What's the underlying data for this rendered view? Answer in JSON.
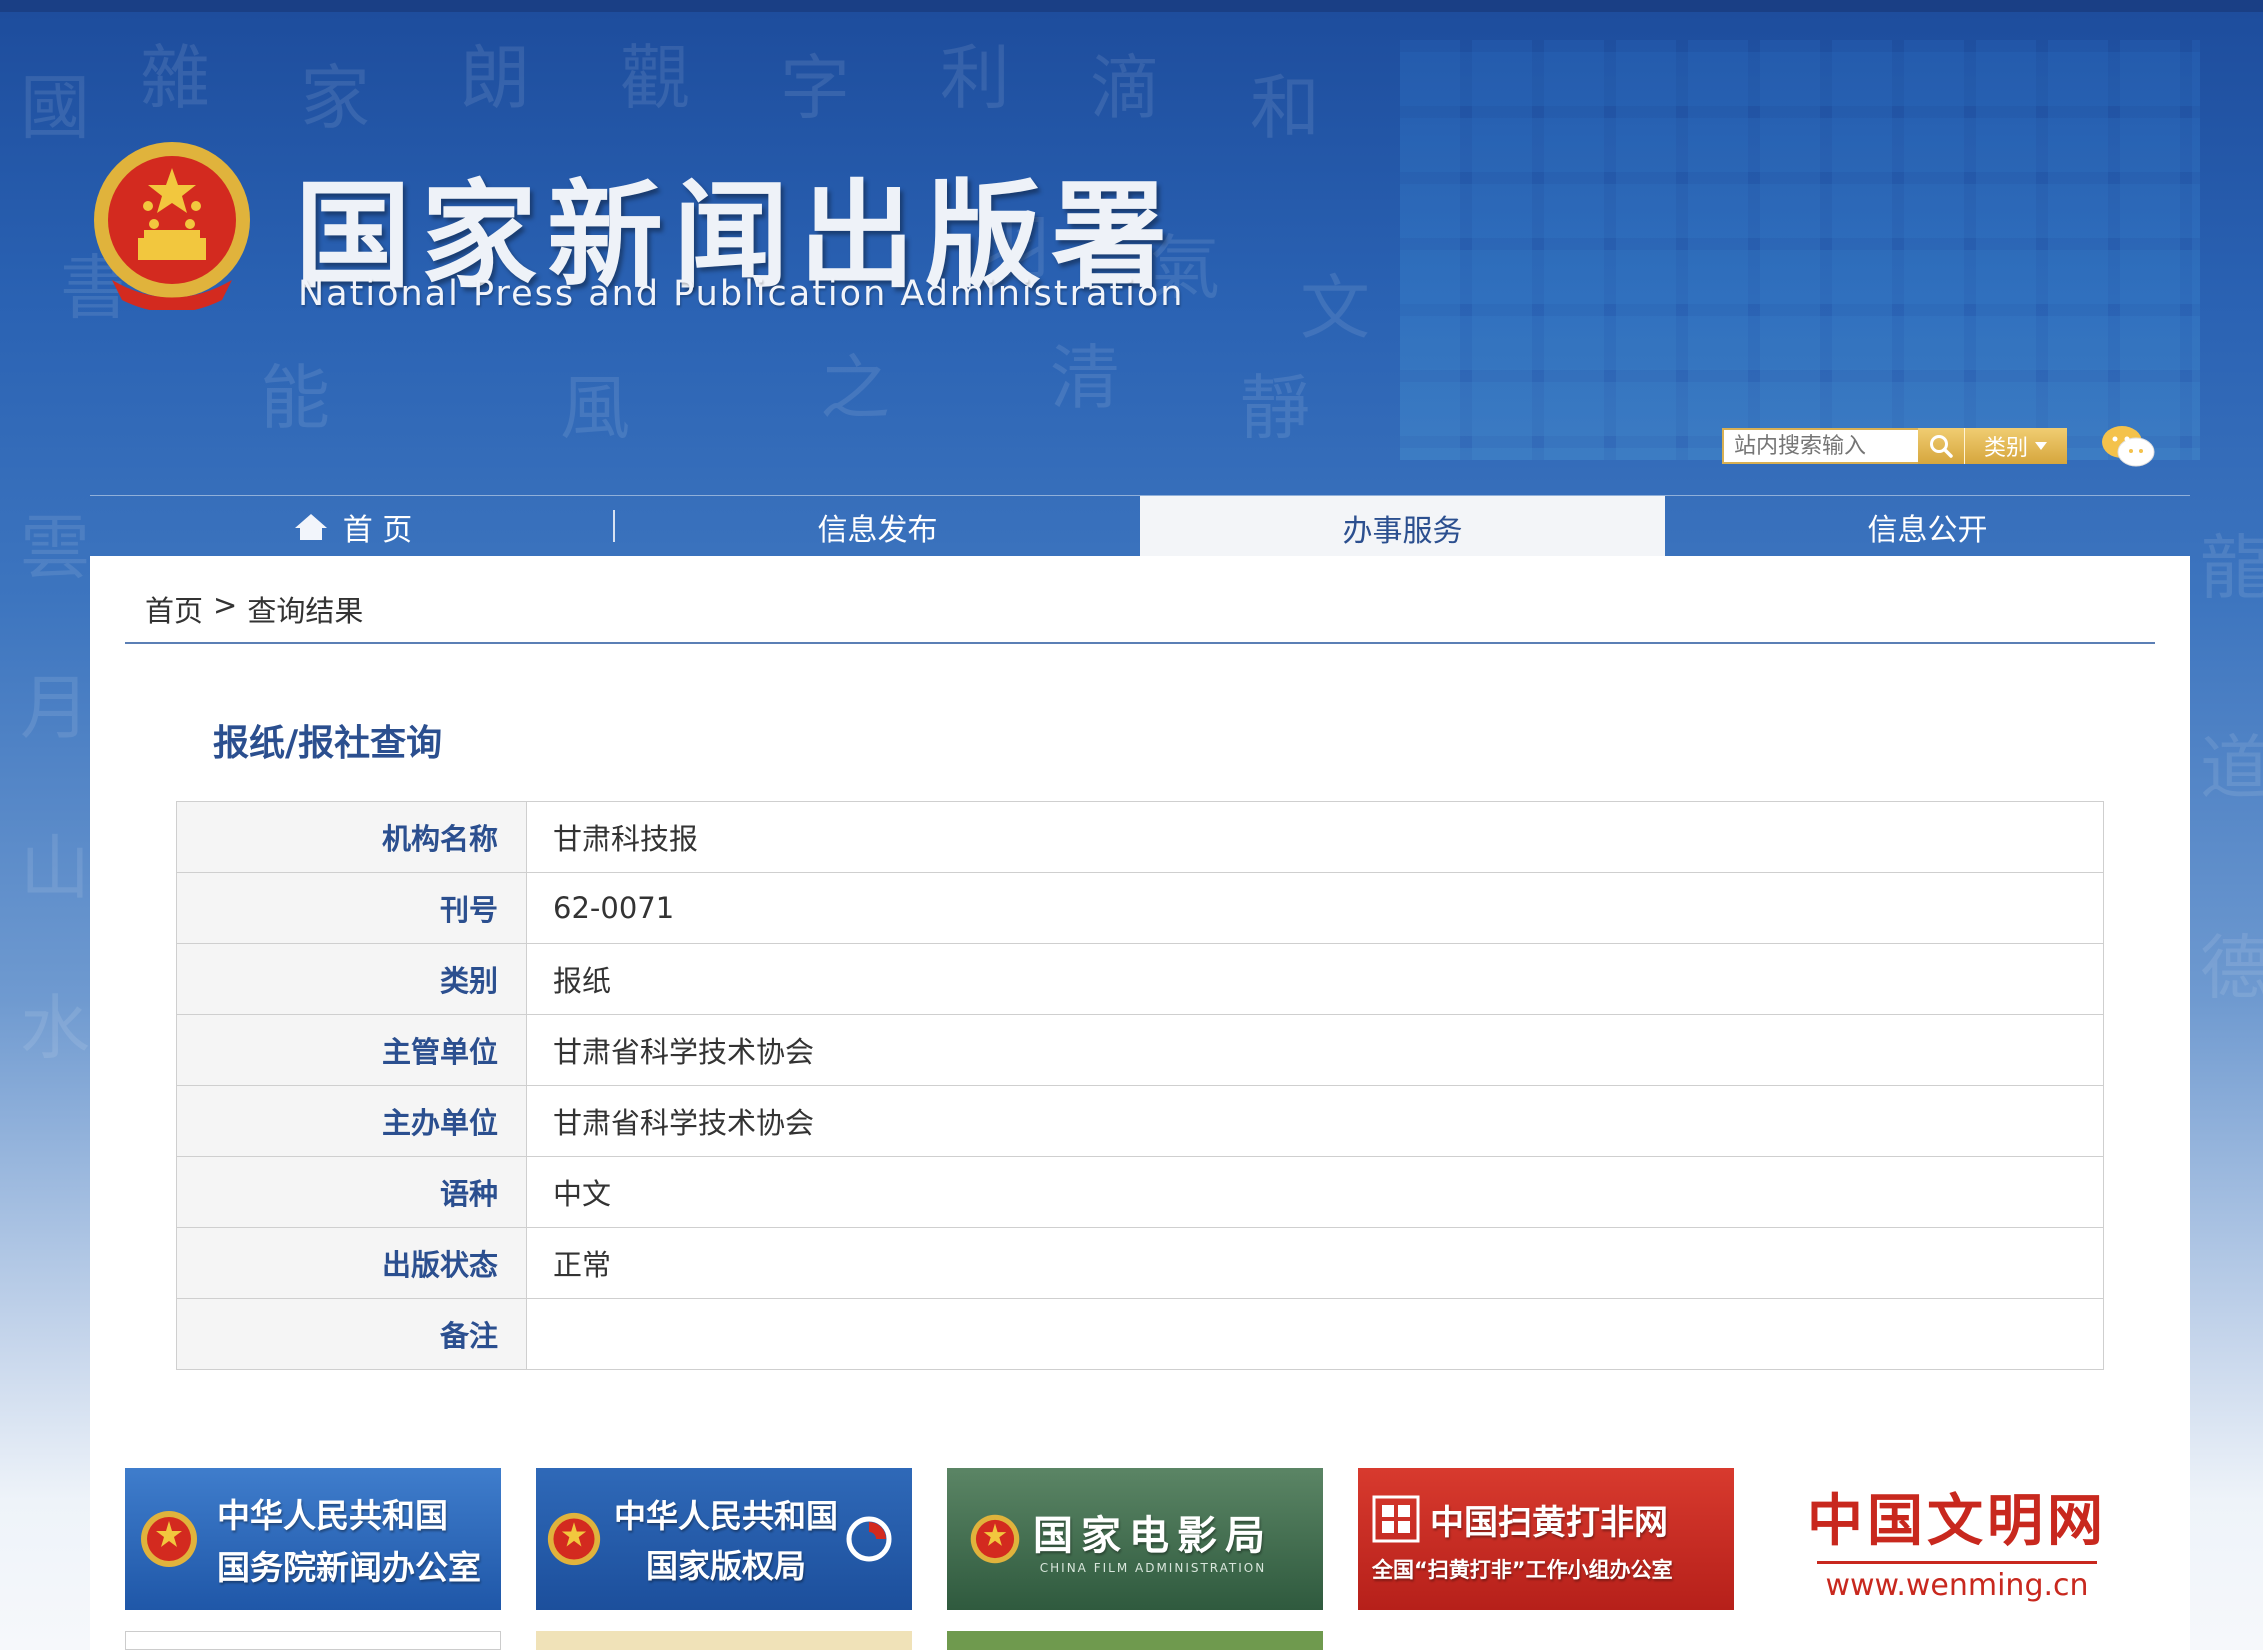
{
  "header": {
    "site_title": "国家新闻出版署",
    "site_subtitle": "National  Press and Publication Administration"
  },
  "search": {
    "placeholder": "站内搜索输入",
    "category_label": "类别"
  },
  "nav": {
    "items": [
      {
        "label": "首 页"
      },
      {
        "label": "信息发布"
      },
      {
        "label": "办事服务"
      },
      {
        "label": "信息公开"
      }
    ]
  },
  "breadcrumb": {
    "home": "首页",
    "separator": ">",
    "current": "查询结果"
  },
  "section_title": "报纸/报社查询",
  "table": {
    "rows": [
      {
        "label": "机构名称",
        "value": "甘肃科技报"
      },
      {
        "label": "刊号",
        "value": "62-0071"
      },
      {
        "label": "类别",
        "value": "报纸"
      },
      {
        "label": "主管单位",
        "value": "甘肃省科学技术协会"
      },
      {
        "label": "主办单位",
        "value": "甘肃省科学技术协会"
      },
      {
        "label": "语种",
        "value": "中文"
      },
      {
        "label": "出版状态",
        "value": "正常"
      },
      {
        "label": "备注",
        "value": ""
      }
    ]
  },
  "links": {
    "scio_line1": "中华人民共和国",
    "scio_line2": "国务院新闻办公室",
    "ncac_line1": "中华人民共和国",
    "ncac_line2": "国家版权局",
    "film_title": "国家电影局",
    "film_subtitle": "CHINA FILM ADMINISTRATION",
    "saohuang_title": "中国扫黄打非网",
    "saohuang_subtitle": "全国“扫黄打非”工作小组办公室",
    "wenming_title": "中国文明网",
    "wenming_url": "www.wenming.cn"
  },
  "colors": {
    "header_blue": "#2a62b3",
    "accent_navy": "#2b4f8f",
    "search_gold": "#d6a63d",
    "scio_blue": "#2d66b8",
    "film_green": "#3f6a4c",
    "saohuang_red": "#c8281e",
    "wenming_red": "#c8281e"
  }
}
